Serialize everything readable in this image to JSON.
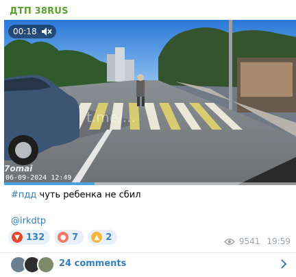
{
  "channel": {
    "name": "ДТП 38RUS"
  },
  "video": {
    "time": "00:18",
    "watermark_left": "7omai",
    "watermark_center": "t.me/...",
    "datestamp": "06-09-2024 12:49",
    "progress": 0.31
  },
  "post": {
    "hashtag": "#пдд",
    "text": "чуть ребенка не сбил",
    "mention": "@irkdtp"
  },
  "reactions": [
    {
      "icon": "angry-face-icon",
      "count": "132",
      "color": "#e8482c"
    },
    {
      "icon": "clown-face-icon",
      "count": "7",
      "color": "#f07b62"
    },
    {
      "icon": "thumbs-up-icon",
      "count": "2",
      "color": "#f4b73a"
    }
  ],
  "meta": {
    "views": "9541",
    "time": "19:59"
  },
  "comments": {
    "label": "24 comments"
  },
  "colors": {
    "accent": "#2f7fc1",
    "channel": "#5aa12e",
    "reaction_bg": "#e8f1fa"
  }
}
